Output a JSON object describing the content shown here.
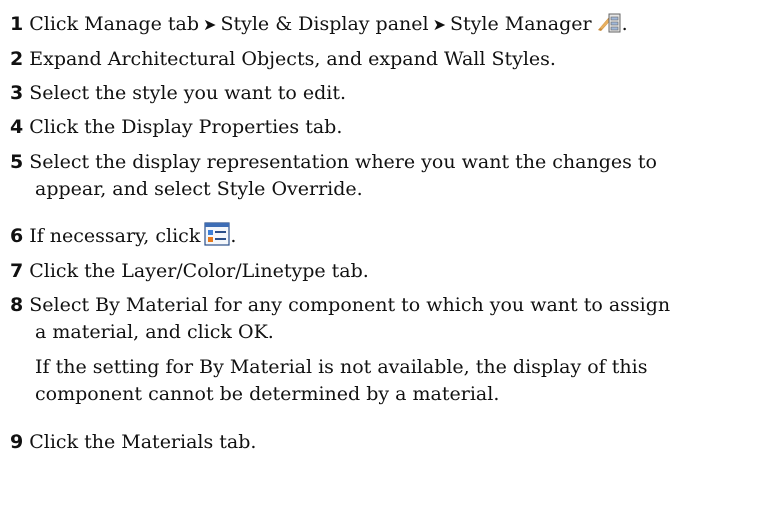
{
  "steps": [
    {
      "number": "1",
      "parts": [
        "Click Manage tab",
        "Style & Display panel",
        "Style Manager"
      ],
      "trailing": ".",
      "icon": "style-manager-icon"
    },
    {
      "number": "2",
      "text": "Expand Architectural Objects, and expand Wall Styles."
    },
    {
      "number": "3",
      "text": "Select the style you want to edit."
    },
    {
      "number": "4",
      "text": "Click the Display Properties tab."
    },
    {
      "number": "5",
      "line1": "Select the display representation where you want the changes to",
      "line2": "appear, and select Style Override."
    },
    {
      "number": "6",
      "text": "If necessary, click",
      "trailing": ".",
      "icon": "edit-display-properties-icon"
    },
    {
      "number": "7",
      "text": "Click the Layer/Color/Linetype tab."
    },
    {
      "number": "8",
      "line1": "Select By Material for any component to which you want to assign",
      "line2": "a material, and click OK.",
      "note1": "If the setting for By Material is not available, the display of this",
      "note2": "component cannot be determined by a material."
    },
    {
      "number": "9",
      "text": "Click the Materials tab."
    }
  ],
  "arrow_glyph": "➤"
}
